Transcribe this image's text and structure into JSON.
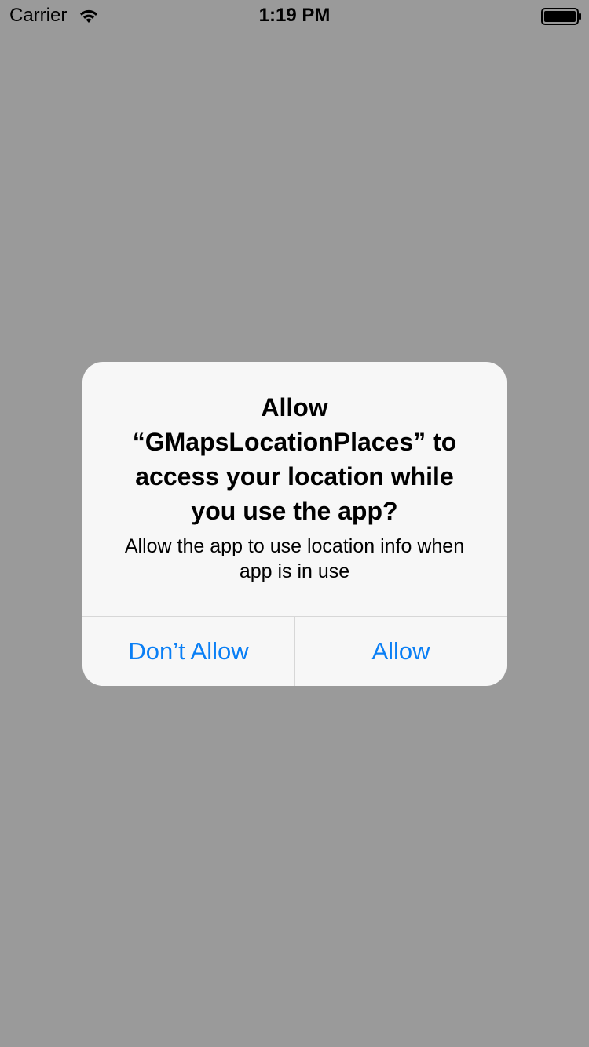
{
  "status_bar": {
    "carrier": "Carrier",
    "time": "1:19 PM",
    "wifi_icon": "wifi-icon",
    "battery_icon": "battery-icon"
  },
  "alert": {
    "title_lines": [
      "Allow",
      "“GMapsLocationPlaces” to",
      "access your location while",
      "you use the app?"
    ],
    "message_lines": [
      "Allow the app to use location info when",
      "app is in use"
    ],
    "buttons": {
      "dont_allow": "Don’t Allow",
      "allow": "Allow"
    }
  },
  "colors": {
    "background_dim": "#9a9a9a",
    "alert_background": "#f7f7f7",
    "button_text": "#0a7ff5",
    "divider": "#d7d7d7"
  }
}
